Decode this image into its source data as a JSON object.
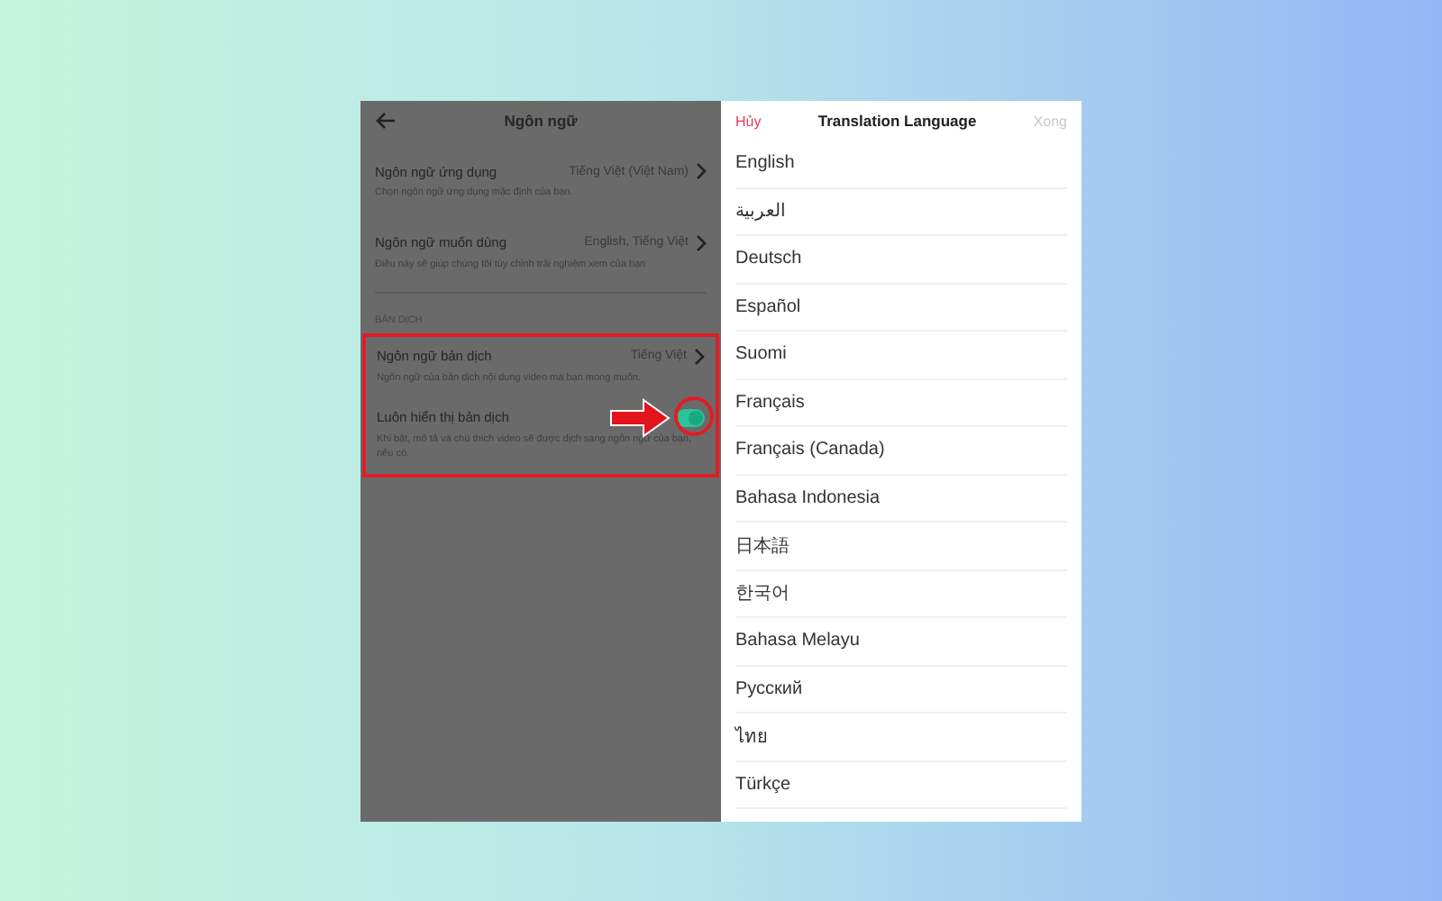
{
  "settings_screen": {
    "title": "Ngôn ngữ",
    "items": [
      {
        "title": "Ngôn ngữ ứng dụng",
        "value": "Tiếng Việt (Việt Nam)",
        "description": "Chọn ngôn ngữ ứng dụng mặc định của bạn."
      },
      {
        "title": "Ngôn ngữ muốn dùng",
        "value": "English, Tiếng Việt",
        "description": "Điều này sẽ giúp chúng tôi tùy chỉnh trải nghiệm xem của bạn"
      }
    ],
    "section": {
      "heading": "BẢN DỊCH",
      "highlighted": true,
      "items": [
        {
          "kind": "link",
          "title": "Ngôn ngữ bản dịch",
          "value": "Tiếng Việt",
          "description": "Ngôn ngữ của bản dịch nội dung video mà bạn mong muốn."
        },
        {
          "kind": "toggle",
          "title": "Luôn hiển thị bản dịch",
          "on": true,
          "highlighted": true,
          "description": "Khi bật, mô tả và chú thích video sẽ được dịch sang ngôn ngữ của bạn, nếu có."
        }
      ]
    }
  },
  "language_sheet": {
    "cancel": "Hủy",
    "title": "Translation Language",
    "done": "Xong",
    "done_disabled": true,
    "languages": [
      {
        "label": "English"
      },
      {
        "label": "العربية"
      },
      {
        "label": "Deutsch"
      },
      {
        "label": "Español"
      },
      {
        "label": "Suomi"
      },
      {
        "label": "Français"
      },
      {
        "label": "Français (Canada)"
      },
      {
        "label": "Bahasa Indonesia"
      },
      {
        "label": "日本語"
      },
      {
        "label": "한국어"
      },
      {
        "label": "Bahasa Melayu"
      },
      {
        "label": "Русский"
      },
      {
        "label": "ไทย"
      },
      {
        "label": "Türkçe"
      }
    ]
  }
}
